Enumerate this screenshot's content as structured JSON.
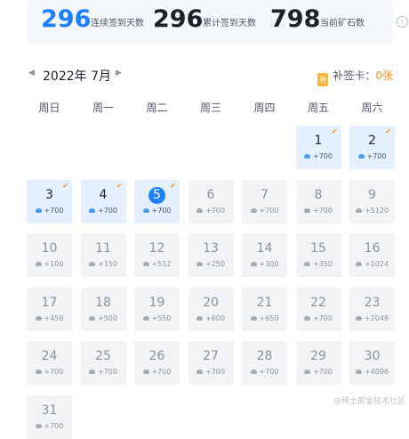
{
  "stats": {
    "consecutive_value": "296",
    "consecutive_label": "连续签到天数",
    "total_value": "296",
    "total_label": "累计签到天数",
    "ore_value": "798",
    "ore_label": "当前矿石数",
    "info_icon": "i"
  },
  "calendar": {
    "month_label": "2022年 7月",
    "prev_icon": "◀",
    "next_icon": "▶",
    "makeup_label": "补签卡：",
    "makeup_count": "0张",
    "weekdays": [
      "周日",
      "周一",
      "周二",
      "周三",
      "周四",
      "周五",
      "周六"
    ],
    "days": [
      {
        "day": "1",
        "reward": "+700",
        "signed": true,
        "checked": true
      },
      {
        "day": "2",
        "reward": "+700",
        "signed": true,
        "checked": true
      },
      {
        "day": "3",
        "reward": "+700",
        "signed": true,
        "checked": true
      },
      {
        "day": "4",
        "reward": "+700",
        "signed": true,
        "checked": true
      },
      {
        "day": "5",
        "reward": "+700",
        "signed": true,
        "checked": true,
        "today": true
      },
      {
        "day": "6",
        "reward": "+700"
      },
      {
        "day": "7",
        "reward": "+700"
      },
      {
        "day": "8",
        "reward": "+700"
      },
      {
        "day": "9",
        "reward": "+5120"
      },
      {
        "day": "10",
        "reward": "+100"
      },
      {
        "day": "11",
        "reward": "+150"
      },
      {
        "day": "12",
        "reward": "+512"
      },
      {
        "day": "13",
        "reward": "+250"
      },
      {
        "day": "14",
        "reward": "+300"
      },
      {
        "day": "15",
        "reward": "+350"
      },
      {
        "day": "16",
        "reward": "+1024"
      },
      {
        "day": "17",
        "reward": "+450"
      },
      {
        "day": "18",
        "reward": "+500"
      },
      {
        "day": "19",
        "reward": "+550"
      },
      {
        "day": "20",
        "reward": "+600"
      },
      {
        "day": "21",
        "reward": "+650"
      },
      {
        "day": "22",
        "reward": "+700"
      },
      {
        "day": "23",
        "reward": "+2048"
      },
      {
        "day": "24",
        "reward": "+700"
      },
      {
        "day": "25",
        "reward": "+700"
      },
      {
        "day": "26",
        "reward": "+700"
      },
      {
        "day": "27",
        "reward": "+700"
      },
      {
        "day": "28",
        "reward": "+700"
      },
      {
        "day": "29",
        "reward": "+700"
      },
      {
        "day": "30",
        "reward": "+4096"
      },
      {
        "day": "31",
        "reward": "+700"
      }
    ]
  },
  "watermark": "@稀土掘金技术社区"
}
